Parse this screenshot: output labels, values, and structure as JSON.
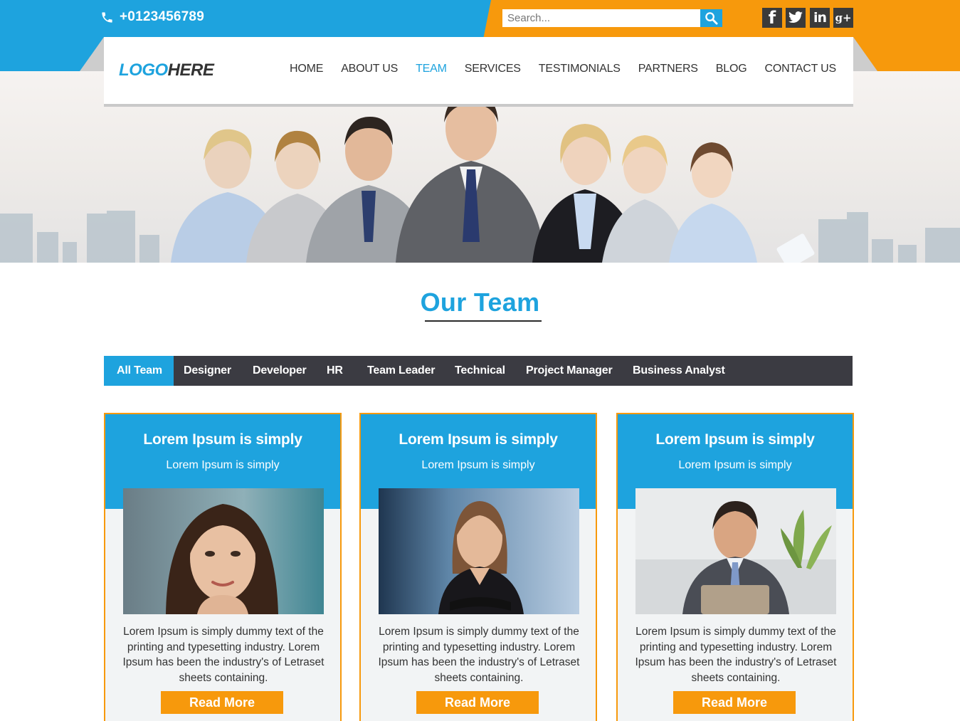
{
  "colors": {
    "primary": "#1ea3de",
    "accent": "#f7990c",
    "dark": "#3b3b42"
  },
  "topbar": {
    "phone": "+0123456789",
    "phone_icon": "phone-icon",
    "search_placeholder": "Search...",
    "search_icon": "search-icon",
    "social": [
      "facebook-icon",
      "twitter-icon",
      "linkedin-icon",
      "google-plus-icon"
    ]
  },
  "logo": {
    "part1": "LOGO",
    "part2": "HERE"
  },
  "nav": [
    {
      "label": "HOME"
    },
    {
      "label": "ABOUT US"
    },
    {
      "label": "TEAM",
      "active": true
    },
    {
      "label": "SERVICES"
    },
    {
      "label": "TESTIMONIALS"
    },
    {
      "label": "PARTNERS"
    },
    {
      "label": "BLOG"
    },
    {
      "label": "CONTACT US"
    }
  ],
  "section": {
    "title": "Our Team"
  },
  "tabs": [
    {
      "label": "All  Team",
      "active": true
    },
    {
      "label": "Designer"
    },
    {
      "label": "Developer"
    },
    {
      "label": "HR"
    },
    {
      "label": "Team Leader"
    },
    {
      "label": "Technical"
    },
    {
      "label": "Project Manager"
    },
    {
      "label": "Business Analyst"
    }
  ],
  "cards": [
    {
      "title": "Lorem Ipsum is simply",
      "subtitle": "Lorem Ipsum is simply",
      "text": "Lorem Ipsum is simply dummy text of the printing and typesetting industry. Lorem Ipsum has been the industry's of Letraset sheets containing.",
      "button": "Read More"
    },
    {
      "title": "Lorem Ipsum is simply",
      "subtitle": "Lorem Ipsum is simply",
      "text": "Lorem Ipsum is simply dummy text of the printing and typesetting industry. Lorem Ipsum has been the industry's of Letraset sheets containing.",
      "button": "Read More"
    },
    {
      "title": "Lorem Ipsum is simply",
      "subtitle": "Lorem Ipsum is simply",
      "text": "Lorem Ipsum is simply dummy text of the printing and typesetting industry. Lorem Ipsum has been the industry's of Letraset sheets containing.",
      "button": "Read More"
    }
  ]
}
